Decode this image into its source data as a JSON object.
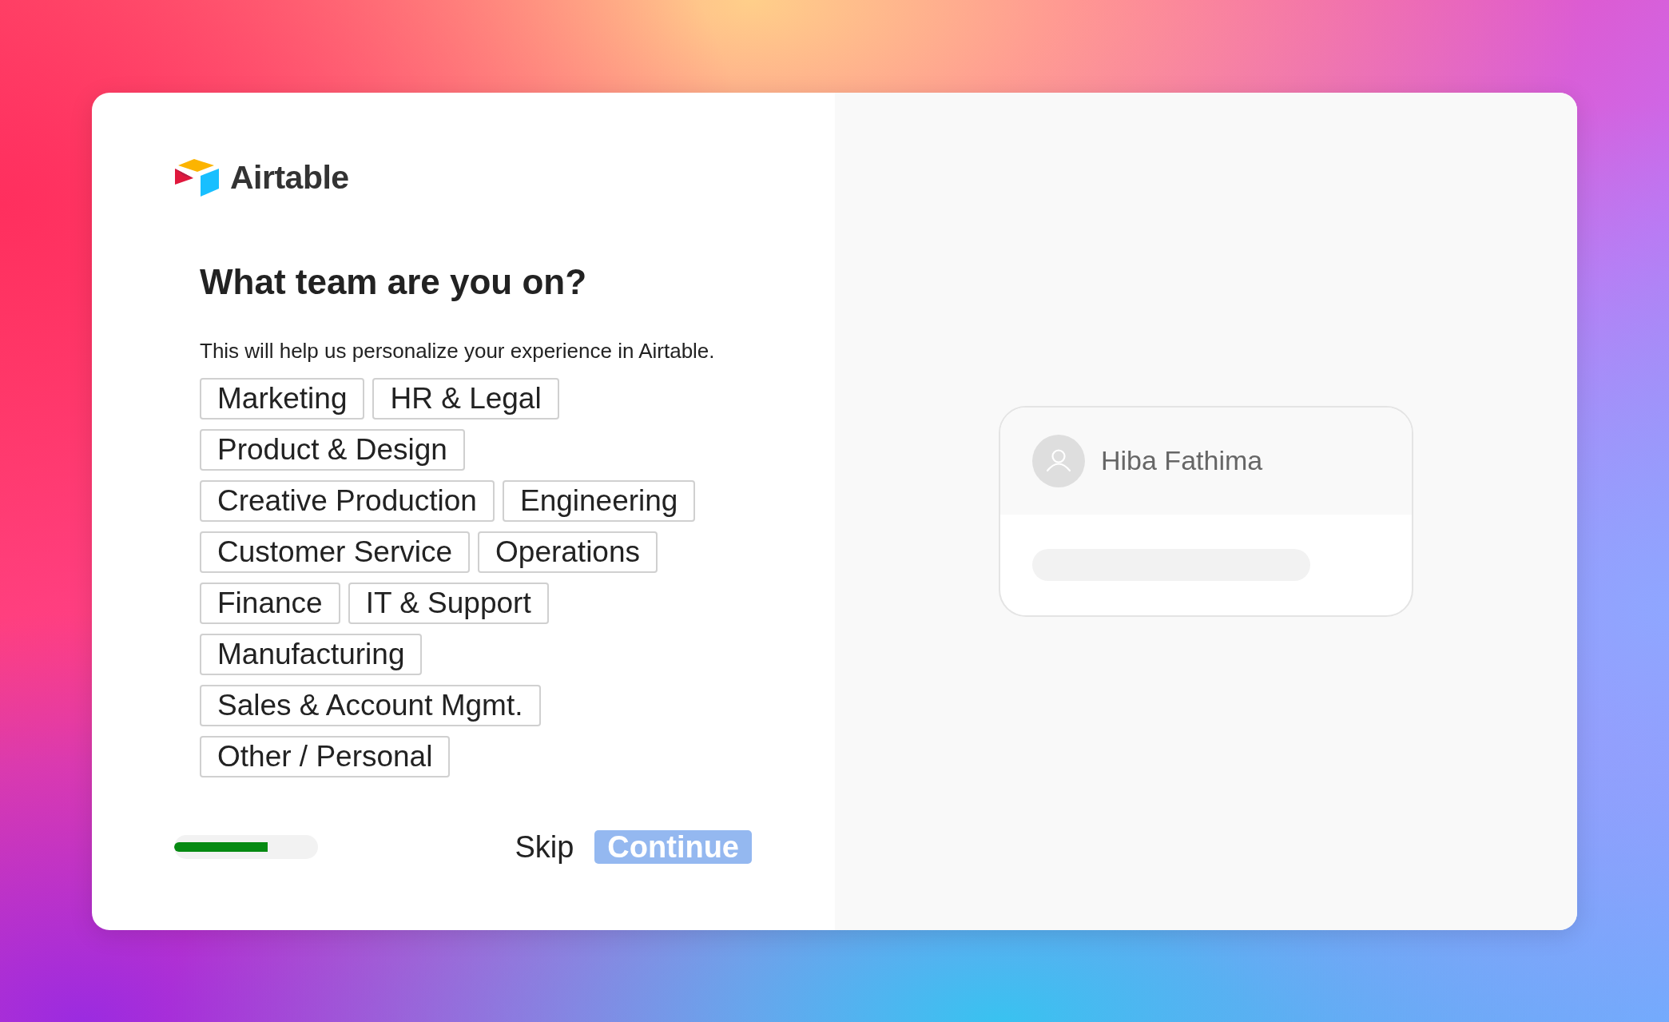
{
  "brand": {
    "name": "Airtable"
  },
  "heading": "What team are you on?",
  "subtitle": "This will help us personalize your experience in Airtable.",
  "teams": [
    {
      "label": "Marketing",
      "selected": false
    },
    {
      "label": "HR & Legal",
      "selected": false
    },
    {
      "label": "Product & Design",
      "selected": false
    },
    {
      "label": "Creative Production",
      "selected": false
    },
    {
      "label": "Engineering",
      "selected": false
    },
    {
      "label": "Customer Service",
      "selected": false
    },
    {
      "label": "Operations",
      "selected": false
    },
    {
      "label": "Finance",
      "selected": false
    },
    {
      "label": "IT & Support",
      "selected": false
    },
    {
      "label": "Manufacturing",
      "selected": false
    },
    {
      "label": "Sales & Account Mgmt.",
      "selected": false
    },
    {
      "label": "Other / Personal",
      "selected": false
    }
  ],
  "progress": {
    "level": 0.65
  },
  "skip": {
    "label": "Skip"
  },
  "continue": {
    "label": "Continue",
    "disabled": true
  },
  "profile": {
    "name": "Hiba Fathima"
  }
}
